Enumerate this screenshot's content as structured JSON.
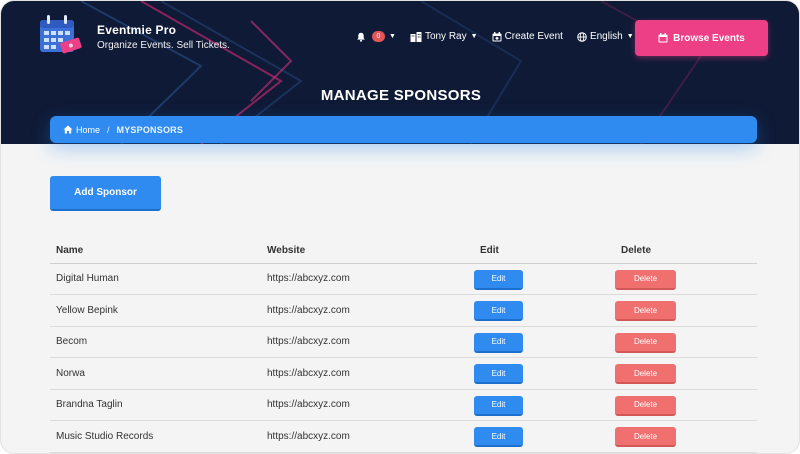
{
  "brand": {
    "title": "Eventmie Pro",
    "tagline": "Organize Events. Sell Tickets."
  },
  "nav": {
    "notifications_count": "0",
    "user_name": "Tony Ray",
    "create_event": "Create Event",
    "language": "English",
    "browse_events": "Browse Events"
  },
  "page": {
    "title": "MANAGE SPONSORS"
  },
  "breadcrumb": {
    "home": "Home",
    "separator": "/",
    "current": "MYSPONSORS"
  },
  "actions": {
    "add_sponsor": "Add Sponsor"
  },
  "table": {
    "headers": {
      "name": "Name",
      "website": "Website",
      "edit": "Edit",
      "delete": "Delete"
    },
    "rows": [
      {
        "name": "Digital Human",
        "website": "https://abcxyz.com",
        "edit": "Edit",
        "delete": "Delete"
      },
      {
        "name": "Yellow Bepink",
        "website": "https://abcxyz.com",
        "edit": "Edit",
        "delete": "Delete"
      },
      {
        "name": "Becom",
        "website": "https://abcxyz.com",
        "edit": "Edit",
        "delete": "Delete"
      },
      {
        "name": "Norwa",
        "website": "https://abcxyz.com",
        "edit": "Edit",
        "delete": "Delete"
      },
      {
        "name": "Brandna Taglin",
        "website": "https://abcxyz.com",
        "edit": "Edit",
        "delete": "Delete"
      },
      {
        "name": "Music Studio Records",
        "website": "https://abcxyz.com",
        "edit": "Edit",
        "delete": "Delete"
      }
    ]
  },
  "colors": {
    "header_bg": "#0f1a36",
    "primary": "#2f8bf0",
    "pink": "#ec3f86",
    "danger": "#f07070"
  },
  "icons": {
    "brand": "calendar-ticket-icon",
    "notifications": "bell-icon",
    "user": "user-building-icon",
    "create": "calendar-icon",
    "language": "globe-icon",
    "browse": "calendar-icon",
    "home": "home-icon"
  }
}
